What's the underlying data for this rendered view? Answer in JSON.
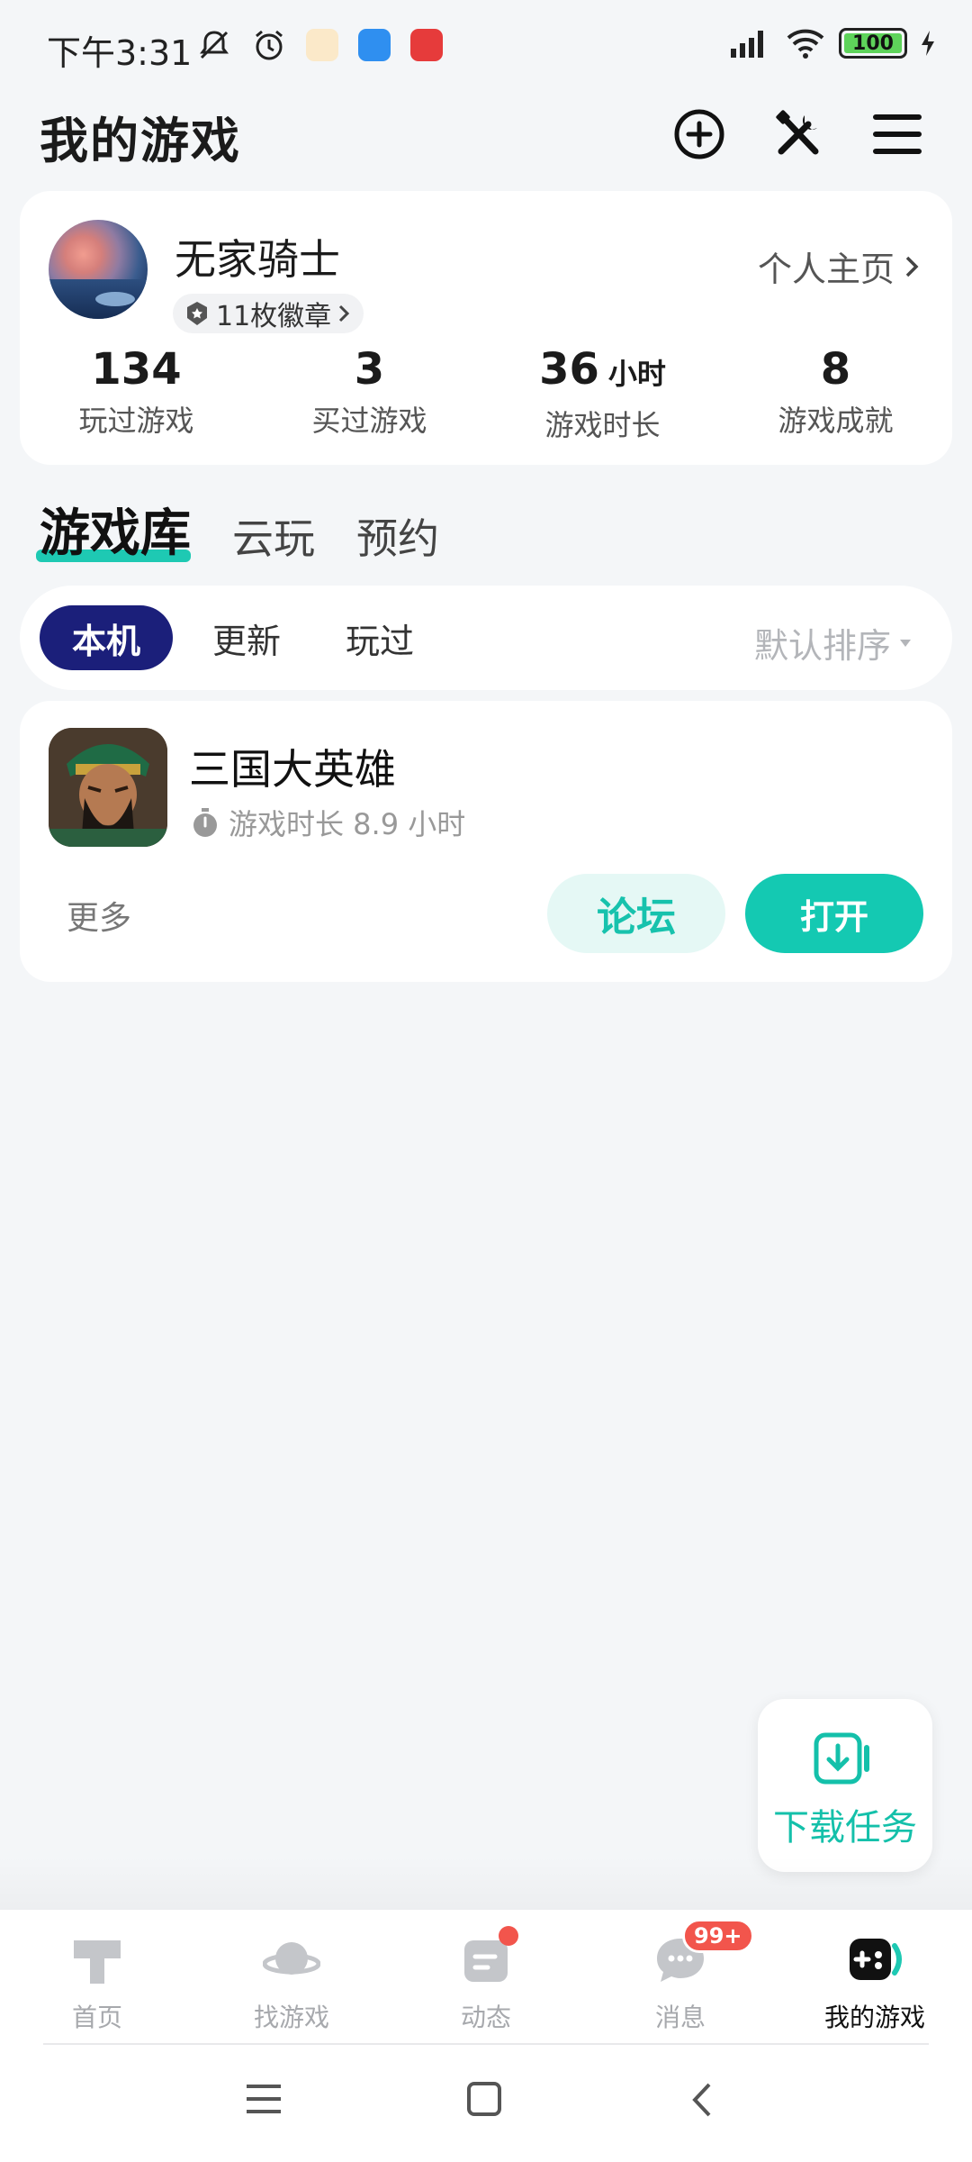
{
  "status_bar": {
    "time": "下午3:31",
    "battery": "100"
  },
  "header": {
    "title": "我的游戏"
  },
  "profile": {
    "username": "无家骑士",
    "badges": "11枚徽章",
    "home_link": "个人主页",
    "stats": [
      {
        "value": "134",
        "unit": "",
        "label": "玩过游戏"
      },
      {
        "value": "3",
        "unit": "",
        "label": "买过游戏"
      },
      {
        "value": "36",
        "unit": "小时",
        "label": "游戏时长"
      },
      {
        "value": "8",
        "unit": "",
        "label": "游戏成就"
      }
    ]
  },
  "library_tabs": [
    {
      "label": "游戏库",
      "active": true
    },
    {
      "label": "云玩",
      "active": false
    },
    {
      "label": "预约",
      "active": false
    }
  ],
  "filters": {
    "chips": [
      {
        "label": "本机",
        "active": true
      },
      {
        "label": "更新",
        "active": false
      },
      {
        "label": "玩过",
        "active": false
      }
    ],
    "sort_label": "默认排序"
  },
  "games": [
    {
      "name": "三国大英雄",
      "playtime": "游戏时长 8.9 小时",
      "more_label": "更多",
      "forum_label": "论坛",
      "open_label": "打开"
    }
  ],
  "download_tasks": {
    "label": "下载任务"
  },
  "bottom_nav": {
    "items": [
      {
        "label": "首页",
        "active": false
      },
      {
        "label": "找游戏",
        "active": false
      },
      {
        "label": "动态",
        "active": false
      },
      {
        "label": "消息",
        "active": false,
        "badge": "99+"
      },
      {
        "label": "我的游戏",
        "active": true
      }
    ]
  },
  "colors": {
    "accent": "#14c9b2",
    "chip_active": "#1b1f7a",
    "badge_red": "#f2554c"
  }
}
